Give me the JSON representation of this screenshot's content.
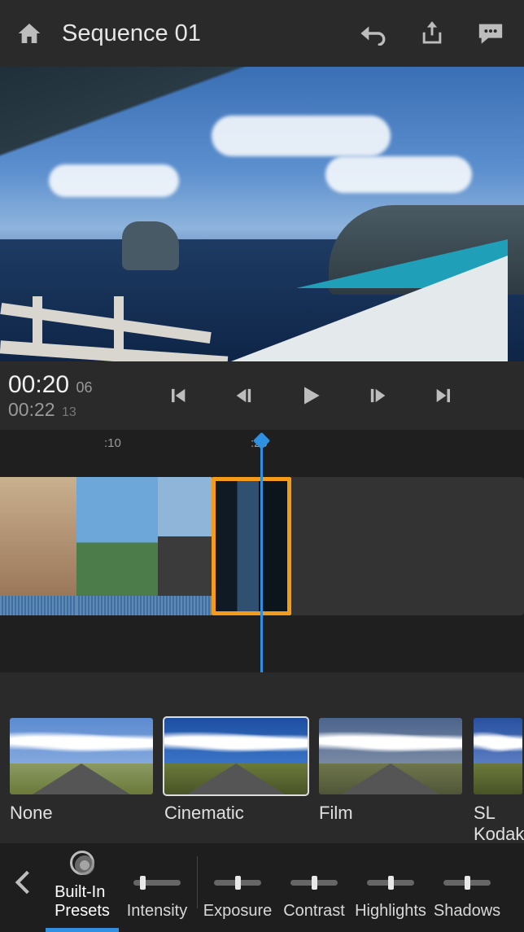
{
  "header": {
    "title": "Sequence 01"
  },
  "playback": {
    "current_time": "00:20",
    "current_frames": "06",
    "duration_time": "00:22",
    "duration_frames": "13"
  },
  "ruler": {
    "tick1": ":10",
    "tick2": ":20"
  },
  "presets": {
    "p0": "None",
    "p1": "Cinematic",
    "p2": "Film",
    "p3": "SL Kodak",
    "selected": "Cinematic"
  },
  "adjust": {
    "builtins_line1": "Built-In",
    "builtins_line2": "Presets",
    "intensity": "Intensity",
    "exposure": "Exposure",
    "contrast": "Contrast",
    "highlights": "Highlights",
    "shadows": "Shadows"
  },
  "sliders": {
    "intensity_pos": 0.15,
    "exposure_pos": 0.5,
    "contrast_pos": 0.5,
    "highlights_pos": 0.5,
    "shadows_pos": 0.5
  }
}
